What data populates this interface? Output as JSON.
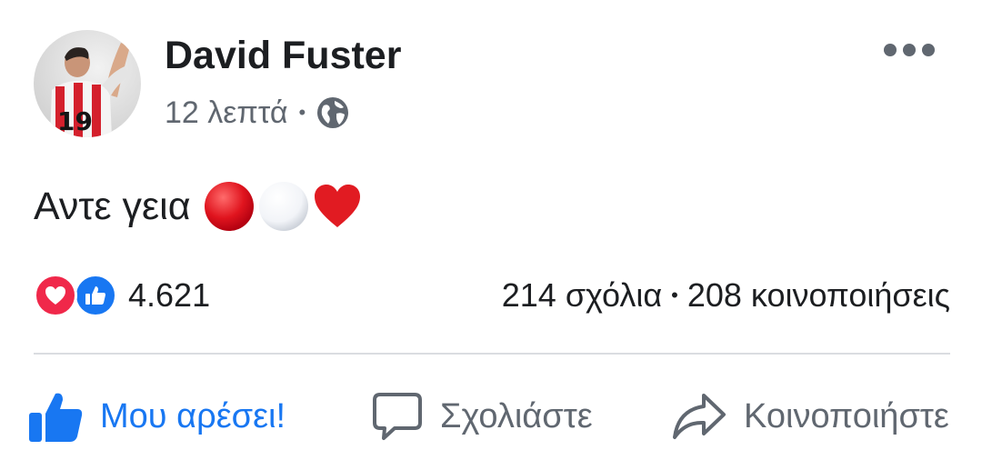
{
  "post": {
    "author": "David Fuster",
    "time": "12 λεπτά",
    "separator": "•",
    "audience_icon": "globe-icon",
    "text": "Αντε γεια",
    "emojis": [
      "red-circle",
      "white-circle",
      "red-heart"
    ]
  },
  "stats": {
    "reaction_icons": [
      "love-reaction-icon",
      "like-reaction-icon"
    ],
    "reactions_count": "4.621",
    "comments": "214 σχόλια",
    "separator": "•",
    "shares": "208 κοινοποιήσεις"
  },
  "actions": {
    "like_label": "Μου αρέσει!",
    "comment_label": "Σχολιάστε",
    "share_label": "Κοινοποιήστε"
  },
  "avatar": {
    "jersey_number": "19"
  },
  "colors": {
    "like_blue": "#1877f2",
    "love_red": "#f0284a",
    "secondary_text": "#606770",
    "divider": "#dadde1"
  }
}
